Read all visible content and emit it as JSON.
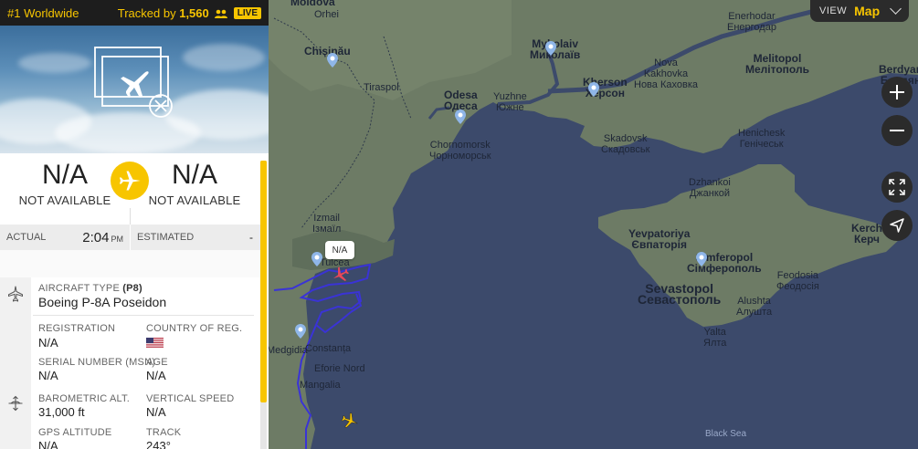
{
  "header": {
    "rank": "#1 Worldwide",
    "tracked_prefix": "Tracked by",
    "tracked_count": "1,560",
    "live": "LIVE"
  },
  "route": {
    "origin_code": "N/A",
    "origin_city": "NOT AVAILABLE",
    "dest_code": "N/A",
    "dest_city": "NOT AVAILABLE"
  },
  "times": {
    "actual_label": "ACTUAL",
    "actual_time": "2:04",
    "actual_ampm": "PM",
    "estimated_label": "ESTIMATED",
    "estimated_value": "-"
  },
  "aircraft": {
    "type_label": "AIRCRAFT TYPE",
    "type_code": "(P8)",
    "type_value": "Boeing P-8A Poseidon",
    "registration_label": "REGISTRATION",
    "registration_value": "N/A",
    "country_label": "COUNTRY OF REG.",
    "serial_label": "SERIAL NUMBER (MSN)",
    "serial_value": "N/A",
    "age_label": "AGE",
    "age_value": "N/A"
  },
  "flight": {
    "baro_alt_label": "BAROMETRIC ALT.",
    "baro_alt_value": "31,000 ft",
    "vspeed_label": "VERTICAL SPEED",
    "vspeed_value": "N/A",
    "gps_alt_label": "GPS ALTITUDE",
    "gps_alt_value": "N/A",
    "track_label": "TRACK",
    "track_value": "243°"
  },
  "map": {
    "view_label": "VIEW",
    "view_value": "Map",
    "callout": "N/A",
    "places": {
      "moldova": "Moldova",
      "orhei": "Orhei",
      "chisinau": "Chișinău",
      "tiraspol": "Tiraspol",
      "mykolaiv_lat": "Mykolaiv",
      "mykolaiv_cyr": "Миколаїв",
      "enerhodar_lat": "Enerhodar",
      "enerhodar_cyr": "Енергодар",
      "nova_kakhovka_lat": "Nova",
      "nova_kakhovka_lat2": "Kakhovka",
      "nova_kakhovka_cyr": "Нова Каховка",
      "melitopol_lat": "Melitopol",
      "melitopol_cyr": "Мелітополь",
      "berdyansk_lat": "Berdyan",
      "berdyansk_cyr": "Бердян",
      "odesa_lat": "Odesa",
      "odesa_cyr": "Одеса",
      "yuzhne_lat": "Yuzhne",
      "yuzhne_cyr": "Южне",
      "kherson_lat": "Kherson",
      "kherson_cyr": "Херсон",
      "chornomorsk_lat": "Chornomorsk",
      "chornomorsk_cyr": "Чорноморськ",
      "skadovsk_lat": "Skadovsk",
      "skadovsk_cyr": "Скадовськ",
      "henichesk_lat": "Henichesk",
      "henichesk_cyr": "Генічеськ",
      "dzhankoi_lat": "Dzhankoi",
      "dzhankoi_cyr": "Джанкой",
      "izmail_lat": "Izmail",
      "izmail_cyr": "Ізмаїл",
      "tulcea": "Tulcea",
      "yevpatoriya_lat": "Yevpatoriya",
      "yevpatoriya_cyr": "Євпаторія",
      "simferopol_lat": "Simferopol",
      "simferopol_cyr": "Сімферополь",
      "kerch_lat": "Kerch",
      "kerch_cyr": "Керч",
      "feodosia_lat": "Feodosia",
      "feodosia_cyr": "Феодосія",
      "sevastopol_lat": "Sevastopol",
      "sevastopol_cyr": "Севастополь",
      "alushta_lat": "Alushta",
      "alushta_cyr": "Алушта",
      "yalta_lat": "Yalta",
      "yalta_cyr": "Ялта",
      "medgidia": "Medgidia",
      "constanta": "Constanța",
      "eforie": "Eforie Nord",
      "mangalia": "Mangalia",
      "black_sea": "Black Sea"
    }
  },
  "colors": {
    "accent": "#f7c500",
    "sea": "#3c4a6b",
    "land": "#6d7b65",
    "track": "#3a33d6",
    "selected_plane": "#e8485a"
  }
}
